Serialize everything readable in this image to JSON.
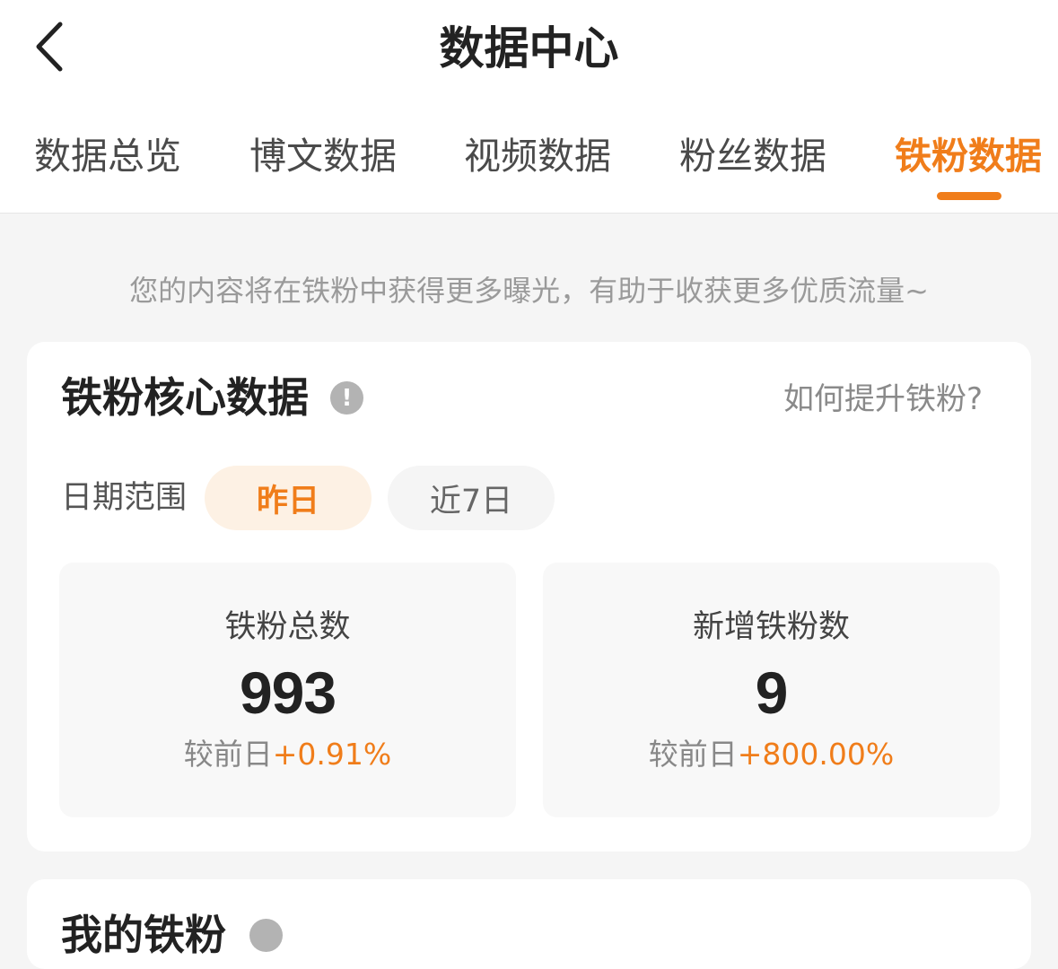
{
  "header": {
    "title": "数据中心",
    "back_icon": "chevron-left-icon"
  },
  "tabs": [
    {
      "label": "数据总览",
      "active": false
    },
    {
      "label": "博文数据",
      "active": false
    },
    {
      "label": "视频数据",
      "active": false
    },
    {
      "label": "粉丝数据",
      "active": false
    },
    {
      "label": "铁粉数据",
      "active": true
    }
  ],
  "notice": "您的内容将在铁粉中获得更多曝光，有助于收获更多优质流量~",
  "core_card": {
    "title": "铁粉核心数据",
    "info_icon": "!",
    "help_link": "如何提升铁粉?",
    "range_label": "日期范围",
    "ranges": [
      {
        "label": "昨日",
        "selected": true
      },
      {
        "label": "近7日",
        "selected": false
      }
    ],
    "stats": [
      {
        "label": "铁粉总数",
        "value": "993",
        "compare_prefix": "较前日",
        "compare_value": "+0.91%"
      },
      {
        "label": "新增铁粉数",
        "value": "9",
        "compare_prefix": "较前日",
        "compare_value": "+800.00%"
      }
    ]
  },
  "fans_card": {
    "title": "我的铁粉"
  },
  "colors": {
    "accent": "#f07d1a",
    "background": "#f5f5f5",
    "card": "#ffffff"
  }
}
